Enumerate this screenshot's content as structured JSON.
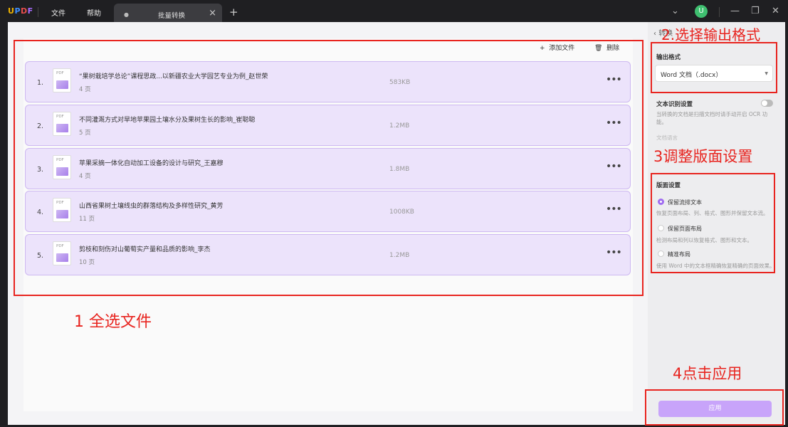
{
  "titlebar": {
    "logo": "UPDF",
    "menu": [
      "文件",
      "帮助"
    ],
    "tab_label": "批量转换",
    "avatar_letter": "U"
  },
  "toolbar": {
    "add_files": "添加文件",
    "delete": "删除"
  },
  "files": [
    {
      "index": "1.",
      "name": "“果树栽培学总论”课程思政...以新疆农业大学园艺专业为例_赵世荣",
      "pages": "4 页",
      "size": "583KB"
    },
    {
      "index": "2.",
      "name": "不同灌溉方式对旱地苹果园土壤水分及果树生长的影响_崔聪聪",
      "pages": "5 页",
      "size": "1.2MB"
    },
    {
      "index": "3.",
      "name": "苹果采摘一体化自动加工设备的设计与研究_王嘉穆",
      "pages": "4 页",
      "size": "1.8MB"
    },
    {
      "index": "4.",
      "name": "山西省果树土壤线虫的群落结构及多样性研究_黄芳",
      "pages": "11 页",
      "size": "1008KB"
    },
    {
      "index": "5.",
      "name": "剪枝和刻伤对山葡萄实产量和品质的影响_李杰",
      "pages": "10 页",
      "size": "1.2MB"
    }
  ],
  "side": {
    "header": "转换",
    "output_format_title": "输出格式",
    "output_format_value": "Word 文档（.docx）",
    "ocr_title": "文本识别设置",
    "ocr_hint": "当转换的文档是扫描文档时请手动开启 OCR 功能。",
    "doc_lang": "文档语言",
    "layout_title": "版面设置",
    "options": [
      {
        "label": "保留流排文本",
        "hint": "恢复页面布局、列、格式、图形并保留文本流。",
        "selected": true
      },
      {
        "label": "保留页面布局",
        "hint": "检测布局和列以恢复格式、图形和文本。",
        "selected": false
      },
      {
        "label": "精准布局",
        "hint": "使用 Word 中的文本框精确恢复精确的页面效果。",
        "selected": false
      }
    ],
    "apply": "应用"
  },
  "annotations": {
    "step1": "1 全选文件",
    "step2": "2.选择输出格式",
    "step3": "3调整版面设置",
    "step4": "4点击应用",
    "color": "#e8241f"
  }
}
